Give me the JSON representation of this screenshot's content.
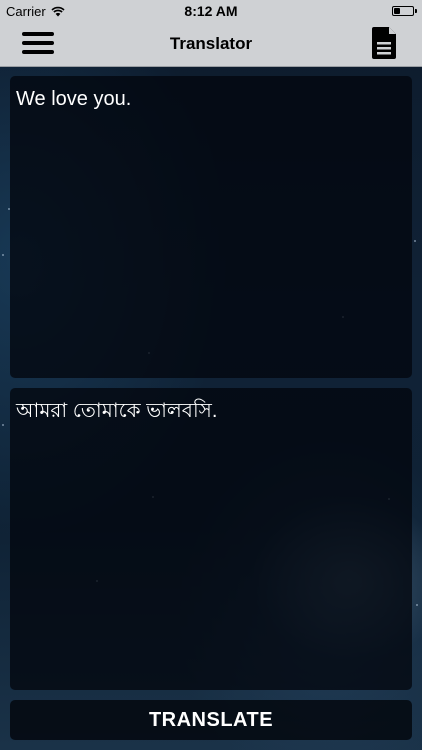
{
  "status_bar": {
    "carrier": "Carrier",
    "time": "8:12 AM",
    "battery_level": 0.35,
    "wifi_icon": "wifi-icon",
    "battery_icon": "battery-icon"
  },
  "nav": {
    "title": "Translator",
    "menu_icon": "hamburger-menu-icon",
    "document_icon": "document-icon"
  },
  "input": {
    "text": "We love you."
  },
  "output": {
    "text": "আমরা তোমাকে ভালবসি."
  },
  "actions": {
    "translate_label": "TRANSLATE"
  },
  "colors": {
    "nav_background": "#cfd1d4",
    "panel_background": "#02060e",
    "text": "#ffffff"
  }
}
